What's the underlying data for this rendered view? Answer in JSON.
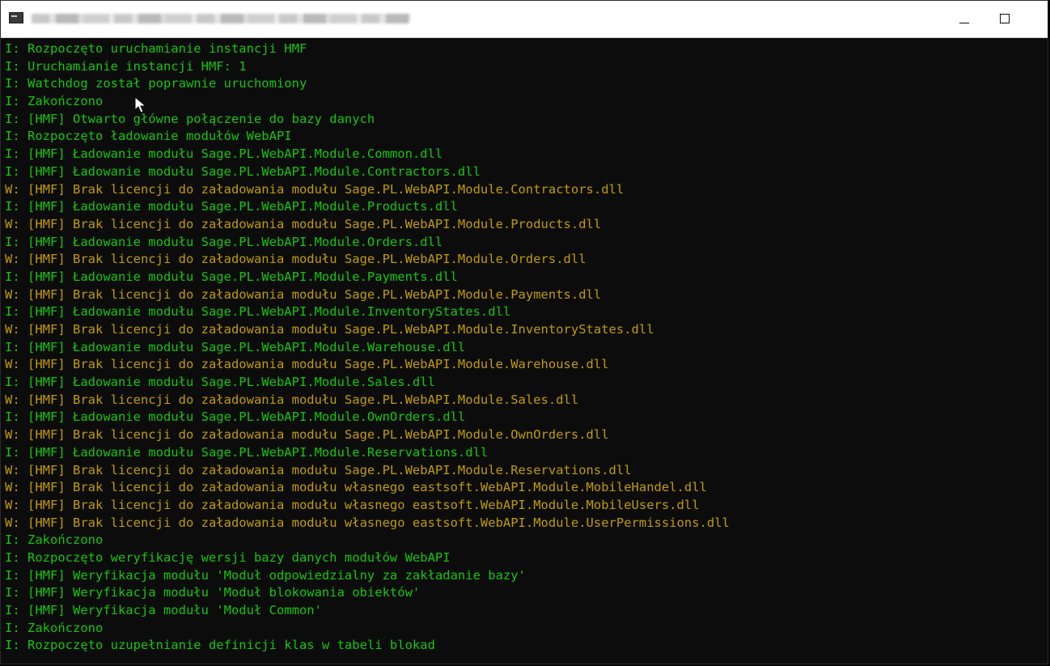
{
  "window": {
    "title": "",
    "icons": {
      "app": "console-app-icon",
      "minimize": "minimize-icon",
      "maximize": "maximize-icon",
      "cursor": "mouse-pointer-icon"
    }
  },
  "colors": {
    "info": "#16c60c",
    "warning": "#c19c00",
    "background": "#0c0c0c"
  },
  "console": {
    "lines": [
      {
        "level": "I",
        "text": "I: Rozpoczęto uruchamianie instancji HMF"
      },
      {
        "level": "I",
        "text": "I: Uruchamianie instancji HMF: 1"
      },
      {
        "level": "I",
        "text": "I: Watchdog został poprawnie uruchomiony"
      },
      {
        "level": "I",
        "text": "I: Zakończono"
      },
      {
        "level": "I",
        "text": "I: [HMF] Otwarto główne połączenie do bazy danych"
      },
      {
        "level": "I",
        "text": "I: Rozpoczęto ładowanie modułów WebAPI"
      },
      {
        "level": "I",
        "text": "I: [HMF] Ładowanie modułu Sage.PL.WebAPI.Module.Common.dll"
      },
      {
        "level": "I",
        "text": "I: [HMF] Ładowanie modułu Sage.PL.WebAPI.Module.Contractors.dll"
      },
      {
        "level": "W",
        "text": "W: [HMF] Brak licencji do załadowania modułu Sage.PL.WebAPI.Module.Contractors.dll"
      },
      {
        "level": "I",
        "text": "I: [HMF] Ładowanie modułu Sage.PL.WebAPI.Module.Products.dll"
      },
      {
        "level": "W",
        "text": "W: [HMF] Brak licencji do załadowania modułu Sage.PL.WebAPI.Module.Products.dll"
      },
      {
        "level": "I",
        "text": "I: [HMF] Ładowanie modułu Sage.PL.WebAPI.Module.Orders.dll"
      },
      {
        "level": "W",
        "text": "W: [HMF] Brak licencji do załadowania modułu Sage.PL.WebAPI.Module.Orders.dll"
      },
      {
        "level": "I",
        "text": "I: [HMF] Ładowanie modułu Sage.PL.WebAPI.Module.Payments.dll"
      },
      {
        "level": "W",
        "text": "W: [HMF] Brak licencji do załadowania modułu Sage.PL.WebAPI.Module.Payments.dll"
      },
      {
        "level": "I",
        "text": "I: [HMF] Ładowanie modułu Sage.PL.WebAPI.Module.InventoryStates.dll"
      },
      {
        "level": "W",
        "text": "W: [HMF] Brak licencji do załadowania modułu Sage.PL.WebAPI.Module.InventoryStates.dll"
      },
      {
        "level": "I",
        "text": "I: [HMF] Ładowanie modułu Sage.PL.WebAPI.Module.Warehouse.dll"
      },
      {
        "level": "W",
        "text": "W: [HMF] Brak licencji do załadowania modułu Sage.PL.WebAPI.Module.Warehouse.dll"
      },
      {
        "level": "I",
        "text": "I: [HMF] Ładowanie modułu Sage.PL.WebAPI.Module.Sales.dll"
      },
      {
        "level": "W",
        "text": "W: [HMF] Brak licencji do załadowania modułu Sage.PL.WebAPI.Module.Sales.dll"
      },
      {
        "level": "I",
        "text": "I: [HMF] Ładowanie modułu Sage.PL.WebAPI.Module.OwnOrders.dll"
      },
      {
        "level": "W",
        "text": "W: [HMF] Brak licencji do załadowania modułu Sage.PL.WebAPI.Module.OwnOrders.dll"
      },
      {
        "level": "I",
        "text": "I: [HMF] Ładowanie modułu Sage.PL.WebAPI.Module.Reservations.dll"
      },
      {
        "level": "W",
        "text": "W: [HMF] Brak licencji do załadowania modułu Sage.PL.WebAPI.Module.Reservations.dll"
      },
      {
        "level": "W",
        "text": "W: [HMF] Brak licencji do załadowania modułu własnego eastsoft.WebAPI.Module.MobileHandel.dll"
      },
      {
        "level": "W",
        "text": "W: [HMF] Brak licencji do załadowania modułu własnego eastsoft.WebAPI.Module.MobileUsers.dll"
      },
      {
        "level": "W",
        "text": "W: [HMF] Brak licencji do załadowania modułu własnego eastsoft.WebAPI.Module.UserPermissions.dll"
      },
      {
        "level": "I",
        "text": "I: Zakończono"
      },
      {
        "level": "I",
        "text": "I: Rozpoczęto weryfikację wersji bazy danych modułów WebAPI"
      },
      {
        "level": "I",
        "text": "I: [HMF] Weryfikacja modułu 'Moduł odpowiedzialny za zakładanie bazy'"
      },
      {
        "level": "I",
        "text": "I: [HMF] Weryfikacja modułu 'Moduł blokowania obiektów'"
      },
      {
        "level": "I",
        "text": "I: [HMF] Weryfikacja modułu 'Moduł Common'"
      },
      {
        "level": "I",
        "text": "I: Zakończono"
      },
      {
        "level": "I",
        "text": "I: Rozpoczęto uzupełnianie definicji klas w tabeli blokad"
      }
    ]
  }
}
